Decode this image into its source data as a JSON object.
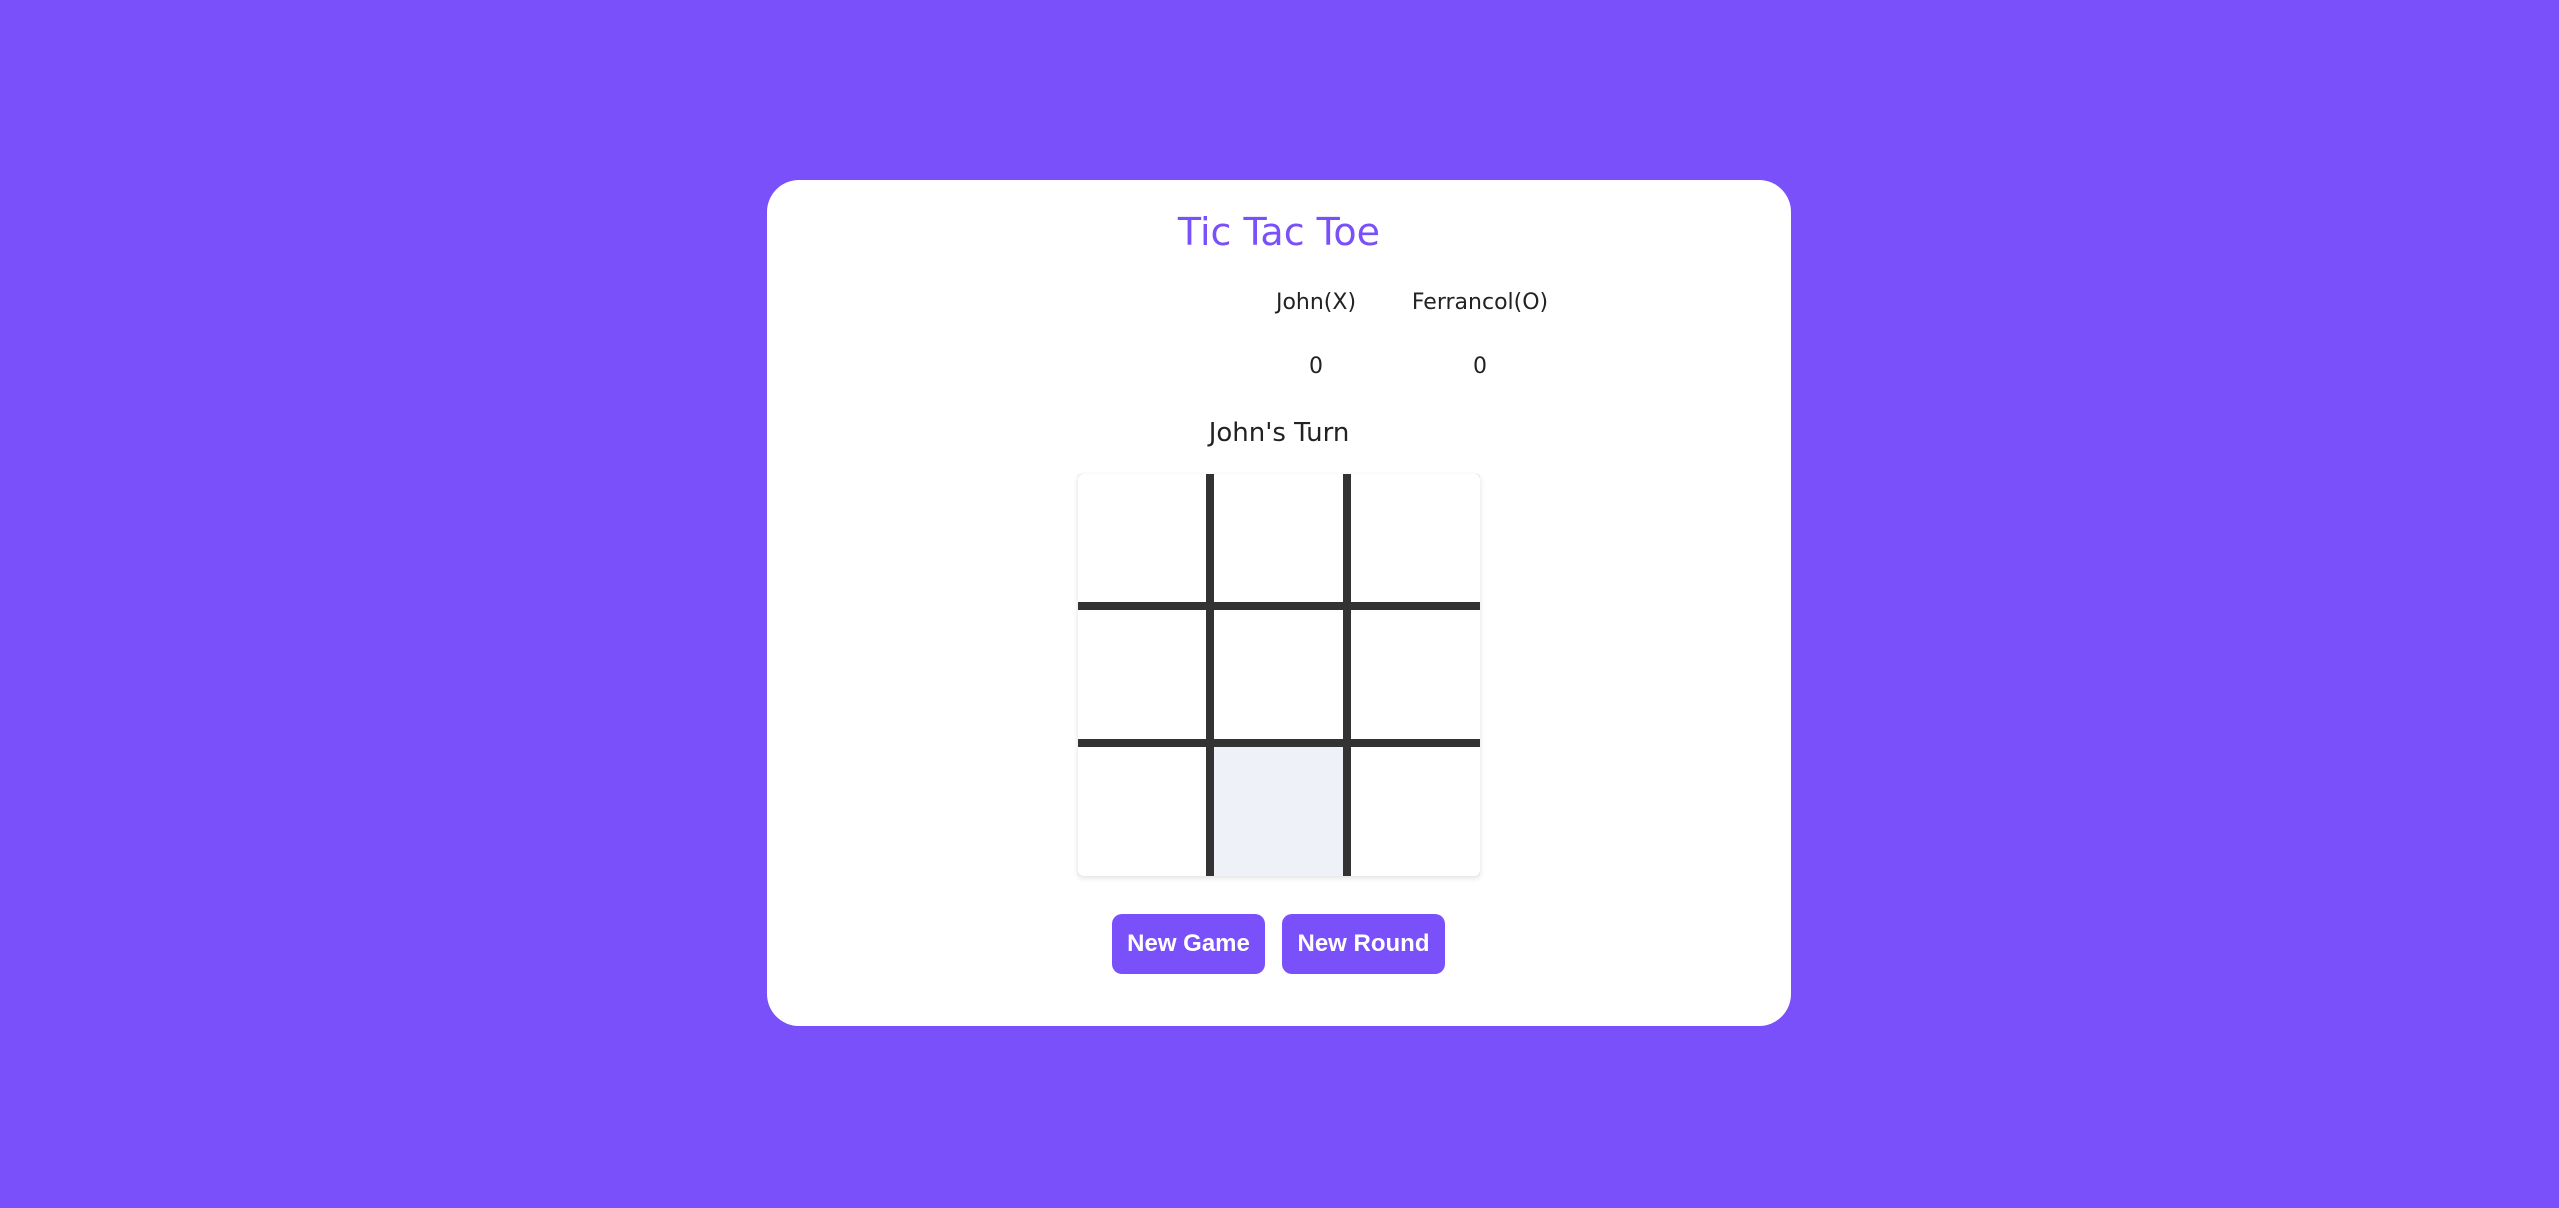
{
  "game": {
    "title": "Tic Tac Toe",
    "players": [
      {
        "name": "John(X)",
        "score": "0"
      },
      {
        "name": "Ferrancol(O)",
        "score": "0"
      }
    ],
    "turn_text": "John's Turn",
    "board": [
      "",
      "",
      "",
      "",
      "",
      "",
      "",
      "",
      ""
    ],
    "buttons": {
      "new_game": "New Game",
      "new_round": "New Round"
    }
  },
  "colors": {
    "accent": "#7950f9",
    "grid_line": "#333333",
    "hover_cell": "#eef1f8"
  }
}
